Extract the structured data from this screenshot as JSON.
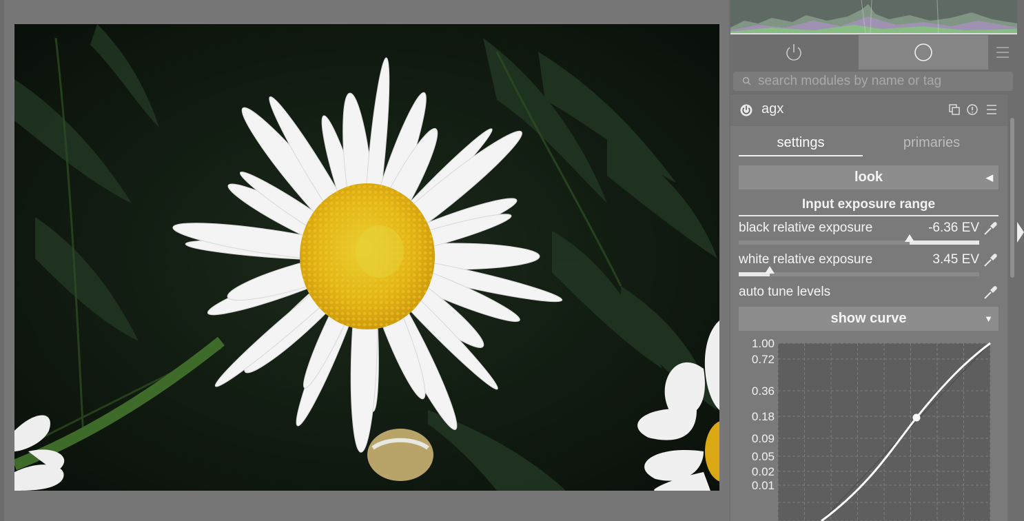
{
  "search": {
    "placeholder": "search modules by name or tag"
  },
  "module": {
    "name": "agx",
    "tabs": [
      {
        "label": "settings",
        "active": true
      },
      {
        "label": "primaries",
        "active": false
      }
    ],
    "sections": {
      "look": {
        "label": "look",
        "collapsed": true
      },
      "input_exposure_range": {
        "label": "Input exposure range"
      },
      "show_curve": {
        "label": "show curve",
        "expanded": true
      }
    },
    "sliders": {
      "black_relative_exposure": {
        "label": "black relative exposure",
        "value_text": "-6.36 EV",
        "position": 0.71
      },
      "white_relative_exposure": {
        "label": "white relative exposure",
        "value_text": "3.45 EV",
        "position": 0.13
      }
    },
    "auto_tune": {
      "label": "auto tune levels"
    }
  },
  "curve": {
    "y_tick_labels": [
      "1.00",
      "0.72",
      "0.36",
      "0.18",
      "0.09",
      "0.05",
      "0.02",
      "0.01"
    ],
    "pivot": {
      "x": 0.65,
      "y": 0.18
    }
  },
  "icons": {
    "tab_power": "power-icon",
    "tab_active": "circle-icon",
    "tab_menu": "hamburger-icon",
    "search": "search-icon",
    "module_power": "power-icon",
    "multi_instance": "multi-instance-icon",
    "reset": "reset-icon",
    "presets": "presets-icon",
    "picker": "color-picker-icon"
  },
  "colors": {
    "panel_bg": "#6e6e6e",
    "module_bg": "#7a7a7a",
    "section_bar": "#8d8d8d",
    "text": "#f2f2f2",
    "petal": "#f4f4f4",
    "flower_center": "#e6b515"
  }
}
